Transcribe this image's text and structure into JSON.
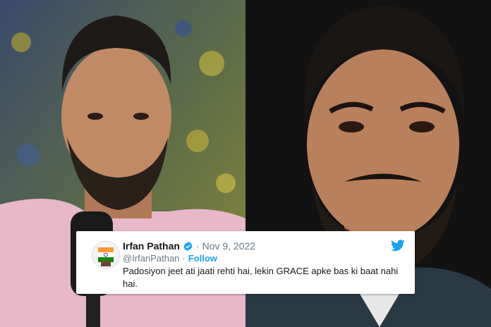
{
  "tweet": {
    "display_name": "Irfan Pathan",
    "date": "Nov 9, 2022",
    "handle": "@IrfanPathan",
    "separator": "·",
    "follow_label": "Follow",
    "text": "Padosiyon jeet ati jaati rehti hai, lekin GRACE apke bas ki baat nahi hai."
  },
  "icons": {
    "verified": "verified-badge-icon",
    "twitter": "twitter-bird-icon",
    "avatar": "avatar-image"
  },
  "colors": {
    "twitter_blue": "#1da1f2",
    "name_text": "#14171a",
    "secondary_text": "#657786",
    "card_bg": "#ffffff"
  }
}
